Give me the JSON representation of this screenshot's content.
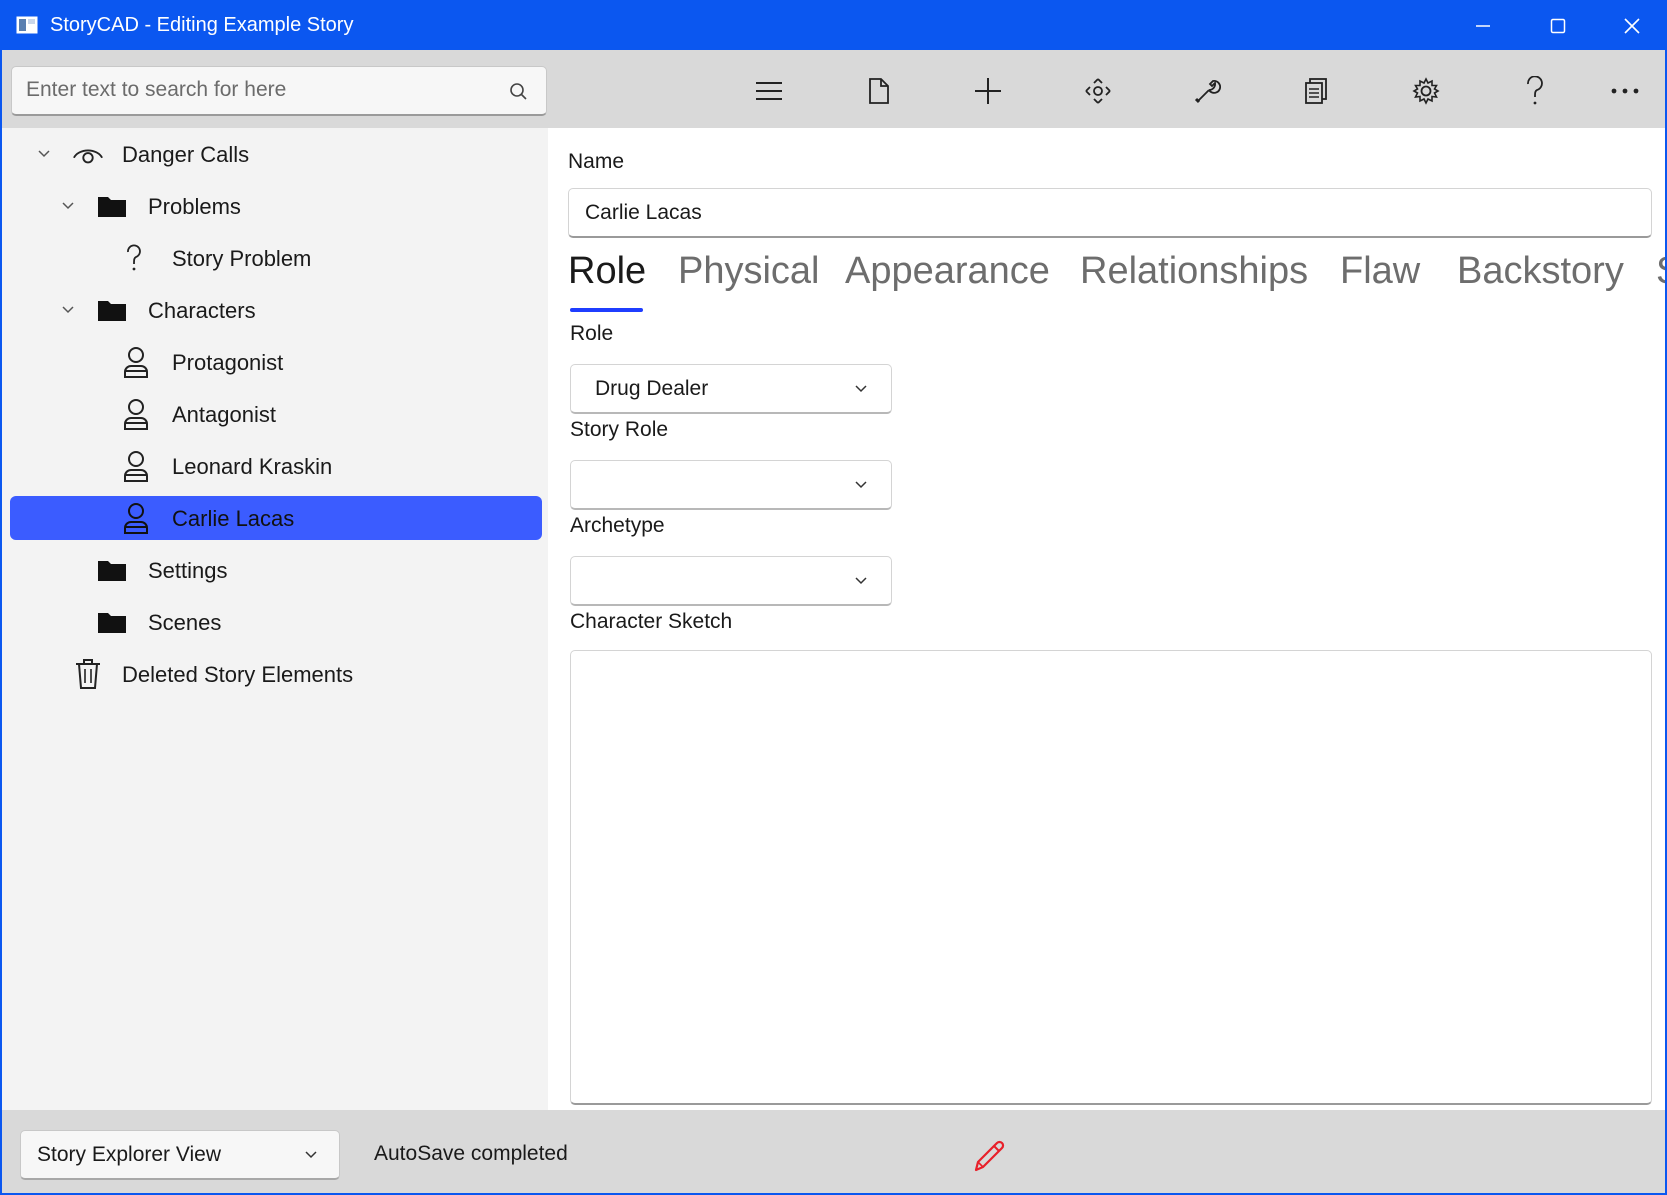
{
  "window": {
    "title": "StoryCAD - Editing Example Story",
    "accent_color": "#0b57f0",
    "controls": [
      "minimize-icon",
      "maximize-icon",
      "close-icon"
    ]
  },
  "toolbar": {
    "search_placeholder": "Enter text to search for here",
    "buttons": [
      "menu-icon",
      "new-file-icon",
      "add-icon",
      "move-icon",
      "tools-icon",
      "reports-icon",
      "settings-icon",
      "help-icon",
      "more-icon"
    ]
  },
  "tree": {
    "root": "Danger Calls",
    "problems_folder": "Problems",
    "story_problem": "Story Problem",
    "characters_folder": "Characters",
    "characters": [
      "Protagonist",
      "Antagonist",
      "Leonard Kraskin",
      "Carlie Lacas"
    ],
    "selected": "Carlie Lacas",
    "settings_folder": "Settings",
    "scenes_folder": "Scenes",
    "trash": "Deleted Story Elements",
    "selection_color": "#3b5cff"
  },
  "content": {
    "name_label": "Name",
    "name_value": "Carlie Lacas",
    "tabs": [
      "Role",
      "Physical",
      "Appearance",
      "Relationships",
      "Flaw",
      "Backstory",
      "S"
    ],
    "active_tab": "Role",
    "role_label": "Role",
    "role_value": "Drug Dealer",
    "story_role_label": "Story Role",
    "story_role_value": "",
    "archetype_label": "Archetype",
    "archetype_value": "",
    "sketch_label": "Character Sketch",
    "sketch_value": ""
  },
  "statusbar": {
    "view_selector": "Story Explorer View",
    "status": "AutoSave completed",
    "edit_indicator_color": "#e8202a"
  }
}
